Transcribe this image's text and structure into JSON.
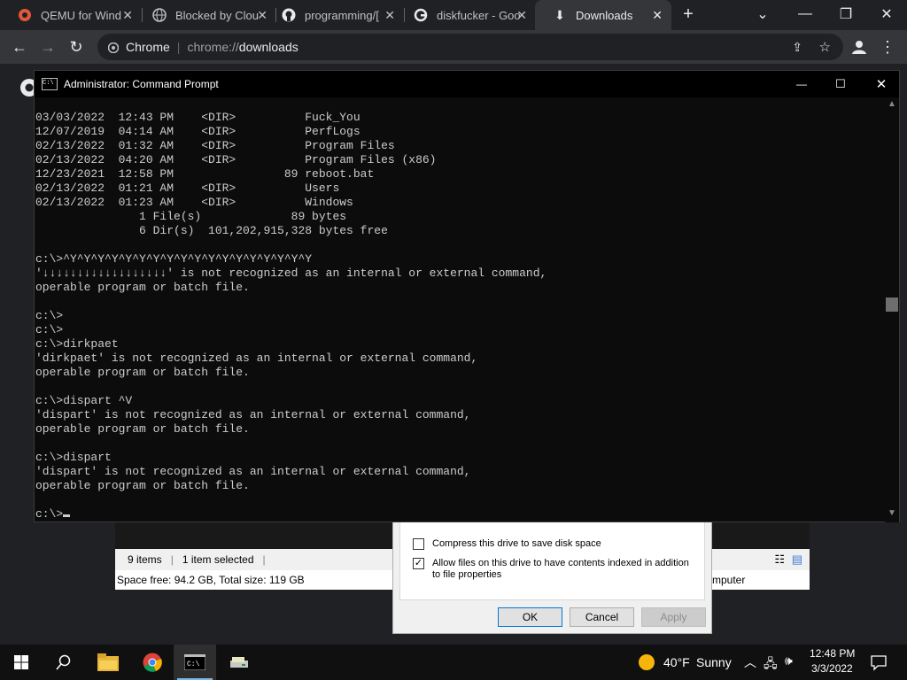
{
  "browser": {
    "tabs": [
      {
        "title": "QEMU for Wind",
        "icon": "qemu-icon"
      },
      {
        "title": "Blocked by Clou",
        "icon": "globe-icon"
      },
      {
        "title": "programming/[",
        "icon": "github-icon"
      },
      {
        "title": "diskfucker - Goo",
        "icon": "google-icon"
      },
      {
        "title": "Downloads",
        "icon": "download-icon",
        "active": true
      }
    ],
    "omnibox": {
      "site": "Chrome",
      "separator": "|",
      "url_scheme": "chrome://",
      "url_host": "downloads"
    }
  },
  "cmd": {
    "title": "Administrator: Command Prompt",
    "icon_text": "C:\\",
    "lines": [
      "03/03/2022  12:43 PM    <DIR>          Fuck_You",
      "12/07/2019  04:14 AM    <DIR>          PerfLogs",
      "02/13/2022  01:32 AM    <DIR>          Program Files",
      "02/13/2022  04:20 AM    <DIR>          Program Files (x86)",
      "12/23/2021  12:58 PM                89 reboot.bat",
      "02/13/2022  01:21 AM    <DIR>          Users",
      "02/13/2022  01:23 AM    <DIR>          Windows",
      "               1 File(s)             89 bytes",
      "               6 Dir(s)  101,202,915,328 bytes free",
      "",
      "c:\\>^Y^Y^Y^Y^Y^Y^Y^Y^Y^Y^Y^Y^Y^Y^Y^Y^Y^Y",
      "'↓↓↓↓↓↓↓↓↓↓↓↓↓↓↓↓↓↓' is not recognized as an internal or external command,",
      "operable program or batch file.",
      "",
      "c:\\>",
      "c:\\>",
      "c:\\>dirkpaet",
      "'dirkpaet' is not recognized as an internal or external command,",
      "operable program or batch file.",
      "",
      "c:\\>dispart ^V",
      "'dispart' is not recognized as an internal or external command,",
      "operable program or batch file.",
      "",
      "c:\\>dispart",
      "'dispart' is not recognized as an internal or external command,",
      "operable program or batch file.",
      ""
    ],
    "prompt": "c:\\>"
  },
  "explorer": {
    "items_count": "9 items",
    "selected": "1 item selected",
    "space": "Space free: 94.2 GB, Total size: 119 GB",
    "partial_label": "mputer"
  },
  "dialog": {
    "compress_label": "Compress this drive to save disk space",
    "compress_checked": false,
    "index_label": "Allow files on this drive to have contents indexed in addition to file properties",
    "index_checked": true,
    "ok": "OK",
    "cancel": "Cancel",
    "apply": "Apply"
  },
  "taskbar": {
    "weather_temp": "40°F",
    "weather_text": "Sunny",
    "time": "12:48 PM",
    "date": "3/3/2022"
  },
  "colors": {
    "cmd_text": "#cccccc",
    "chrome_bg": "#202124",
    "tab_active": "#35363a"
  }
}
